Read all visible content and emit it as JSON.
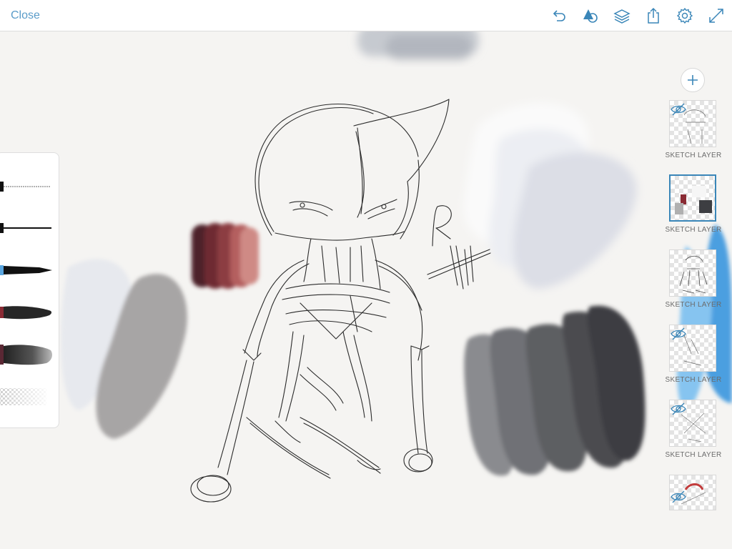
{
  "topbar": {
    "close_label": "Close",
    "icons": [
      "undo-icon",
      "shape-tools-icon",
      "layers-icon",
      "share-icon",
      "settings-icon",
      "fullscreen-icon"
    ]
  },
  "brush_panel": {
    "tools": [
      "pencil-brush",
      "ink-brush",
      "marker-brush",
      "paint-brush",
      "watercolor-brush",
      "eraser"
    ],
    "colors": {
      "accent": "#3a86b8",
      "paint": "#8a2b34",
      "watercolor": "#5a2834"
    }
  },
  "layers": {
    "add_icon": "plus-icon",
    "items": [
      {
        "label": "SKETCH LAYER",
        "hidden": true,
        "selected": false
      },
      {
        "label": "SKETCH LAYER",
        "hidden": false,
        "selected": true
      },
      {
        "label": "SKETCH LAYER",
        "hidden": false,
        "selected": false
      },
      {
        "label": "SKETCH LAYER",
        "hidden": true,
        "selected": false
      },
      {
        "label": "SKETCH LAYER",
        "hidden": true,
        "selected": false
      },
      {
        "label": "",
        "hidden": true,
        "selected": false
      }
    ]
  },
  "canvas": {
    "accent_color": "#5a9cc9"
  }
}
